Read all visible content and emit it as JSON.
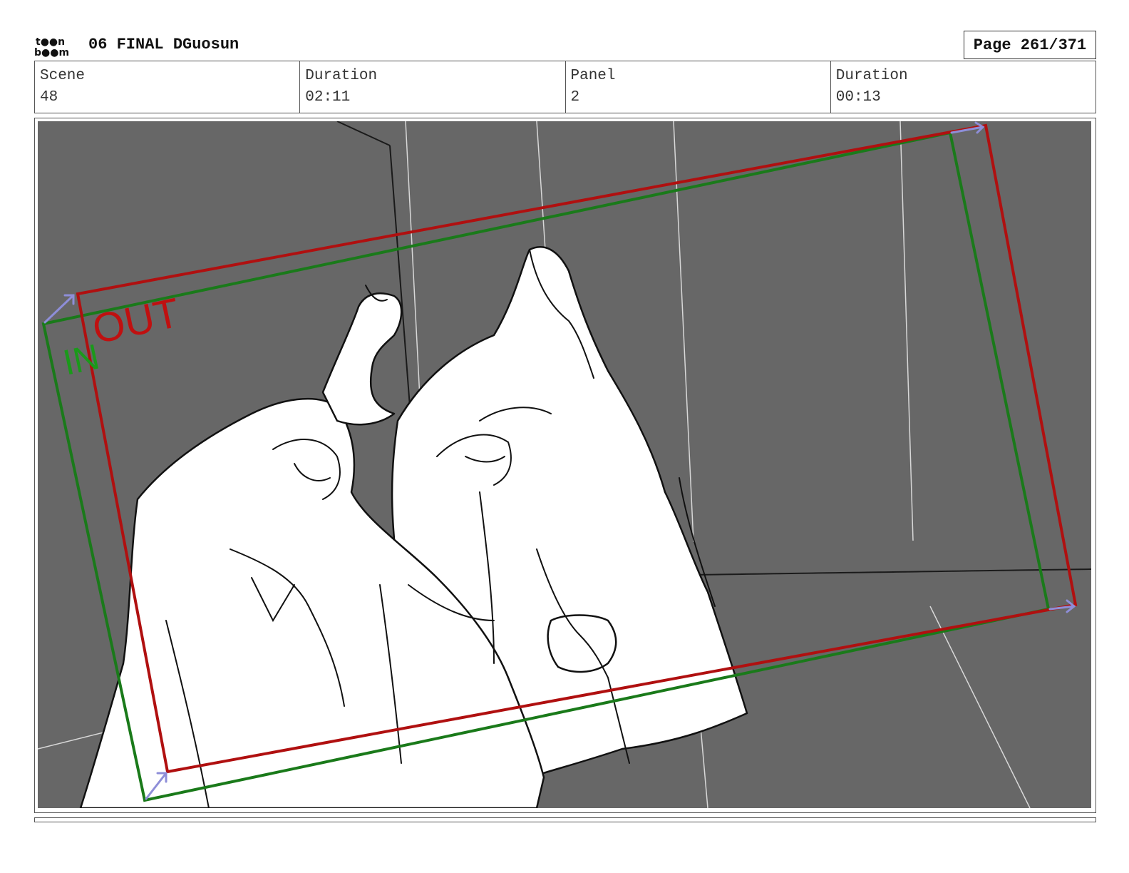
{
  "header": {
    "logo_text": "toon boom",
    "title": "06 FINAL DGuosun",
    "page": "Page 261/371"
  },
  "info": [
    {
      "label": "Scene",
      "value": "48"
    },
    {
      "label": "Duration",
      "value": "02:11"
    },
    {
      "label": "Panel",
      "value": "2"
    },
    {
      "label": "Duration",
      "value": "00:13"
    }
  ],
  "panel": {
    "in_label": "IN",
    "out_label": "OUT",
    "colors": {
      "background": "#676767",
      "in_frame": "#1a7a1a",
      "out_frame": "#b01010",
      "arrows": "#8e8ed8",
      "sketch": "#111111"
    }
  }
}
